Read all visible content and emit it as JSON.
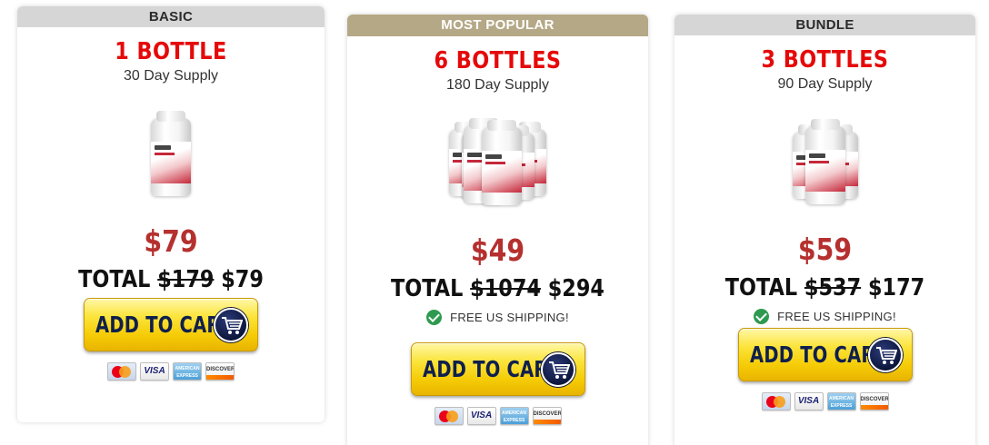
{
  "offers": [
    {
      "header": "BASIC",
      "quantity": "1 BOTTLE",
      "supply": "30 Day Supply",
      "price": "$79",
      "total_label": "TOTAL",
      "old_total": "$179",
      "new_total": "$79",
      "shipping": "",
      "button_label": "ADD TO CART",
      "bottle_count": 1
    },
    {
      "header": "MOST POPULAR",
      "quantity": "6 BOTTLES",
      "supply": "180 Day Supply",
      "price": "$49",
      "total_label": "TOTAL",
      "old_total": "$1074",
      "new_total": "$294",
      "shipping": "FREE US SHIPPING!",
      "button_label": "ADD TO CART",
      "bottle_count": 6
    },
    {
      "header": "BUNDLE",
      "quantity": "3 BOTTLES",
      "supply": "90 Day Supply",
      "price": "$59",
      "total_label": "TOTAL",
      "old_total": "$537",
      "new_total": "$177",
      "shipping": "FREE US SHIPPING!",
      "button_label": "ADD TO CART",
      "bottle_count": 3
    }
  ],
  "payment_cards": [
    "mastercard-icon",
    "visa-icon",
    "american-express-icon",
    "discover-icon"
  ],
  "colors": {
    "quantity_red": "#e50909",
    "price_red": "#b5302e",
    "popular_header": "#b5a886",
    "header_gray": "#d6d6d6",
    "button_yellow": "#fbe43a",
    "button_text_navy": "#0f1f4d",
    "check_green": "#2e9a4f"
  }
}
